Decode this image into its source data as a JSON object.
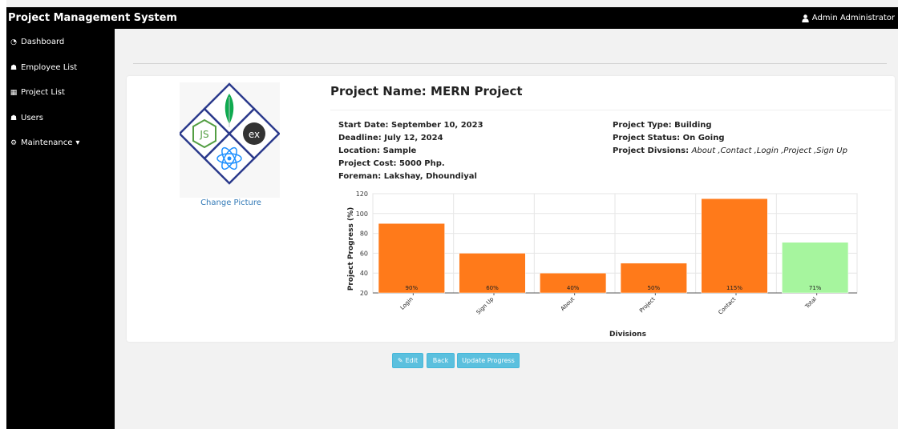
{
  "app": {
    "title": "Project Management System",
    "user": "Admin Administrator",
    "user_icon": "user-icon"
  },
  "sidebar": {
    "items": [
      {
        "label": "Dashboard",
        "icon": "dashboard-icon"
      },
      {
        "label": "Employee List",
        "icon": "users-icon"
      },
      {
        "label": "Project List",
        "icon": "building-icon"
      },
      {
        "label": "Users",
        "icon": "users-icon"
      },
      {
        "label": "Maintenance",
        "icon": "cogs-icon",
        "caret": "▾"
      }
    ]
  },
  "project": {
    "change_picture": "Change Picture",
    "name_label": "Project Name:",
    "name": "MERN Project",
    "start_date": "Start Date: September 10, 2023",
    "deadline": "Deadline: July 12, 2024",
    "location": "Location: Sample",
    "cost": "Project Cost: 5000 Php.",
    "foreman": "Foreman: Lakshay, Dhoundiyal",
    "type": "Project Type: Building",
    "status": "Project Status: On Going",
    "divisions_label": "Project Divsions:",
    "divisions": "About ,Contact ,Login ,Project ,Sign Up",
    "logo_texts": {
      "js": "JS",
      "ex": "ex"
    }
  },
  "buttons": {
    "edit": "Edit",
    "back": "Back",
    "update": "Update Progress"
  },
  "chart_data": {
    "type": "bar",
    "categories": [
      "Login",
      "Sign Up",
      "About",
      "Project",
      "Contact",
      "Total"
    ],
    "values": [
      90,
      60,
      40,
      50,
      115,
      71
    ],
    "value_labels": [
      "90%",
      "60%",
      "40%",
      "50%",
      "115%",
      "71%"
    ],
    "colors": [
      "#ff7a1a",
      "#ff7a1a",
      "#ff7a1a",
      "#ff7a1a",
      "#ff7a1a",
      "#a6f59e"
    ],
    "xlabel": "Divisions",
    "ylabel": "Project Progress (%)",
    "ylim": [
      20,
      120
    ],
    "yticks": [
      20,
      40,
      60,
      80,
      100,
      120
    ],
    "grid": true
  }
}
